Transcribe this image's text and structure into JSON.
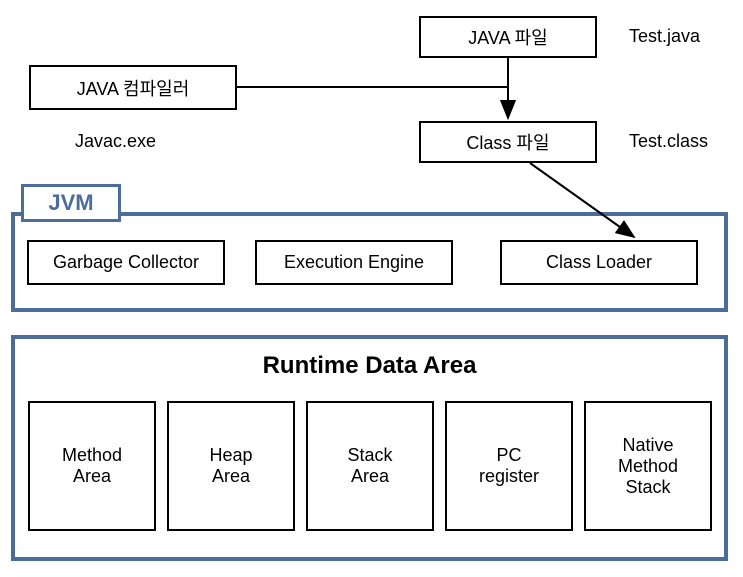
{
  "top": {
    "java_file": "JAVA 파일",
    "java_file_note": "Test.java",
    "compiler": "JAVA 컴파일러",
    "compiler_note": "Javac.exe",
    "class_file": "Class 파일",
    "class_file_note": "Test.class"
  },
  "jvm": {
    "label": "JVM",
    "garbage_collector": "Garbage Collector",
    "execution_engine": "Execution Engine",
    "class_loader": "Class Loader"
  },
  "rda": {
    "title": "Runtime Data Area",
    "method_area": "Method\nArea",
    "heap_area": "Heap\nArea",
    "stack_area": "Stack\nArea",
    "pc_register": "PC\nregister",
    "native_method_stack": "Native\nMethod\nStack"
  }
}
